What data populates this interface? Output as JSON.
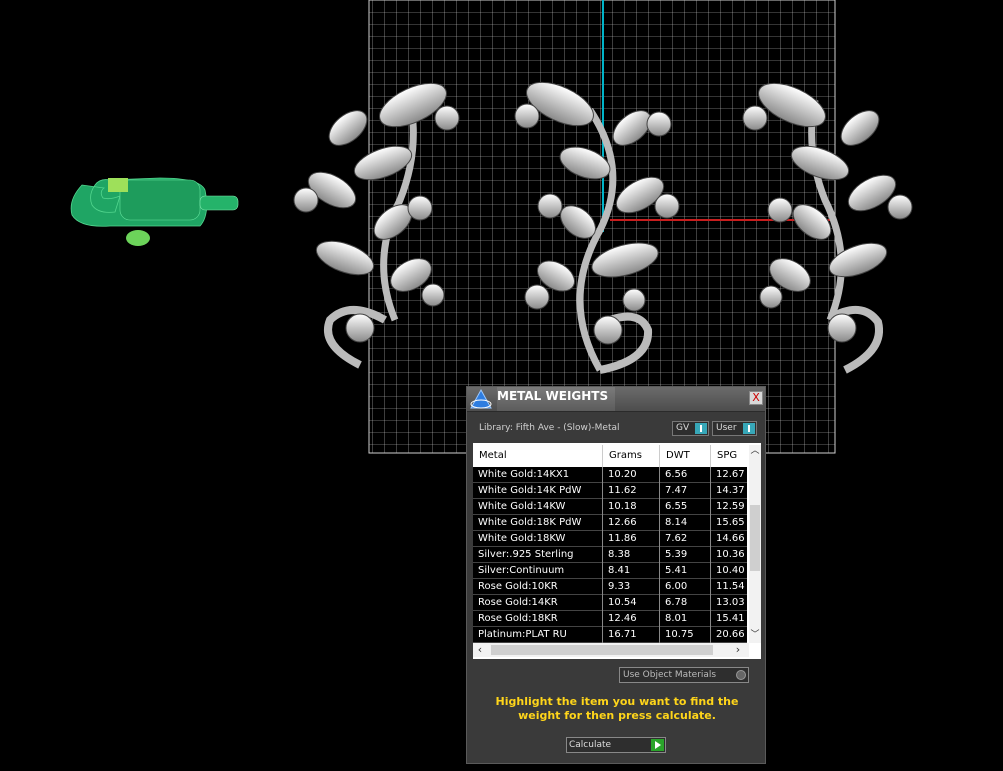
{
  "dialog": {
    "title": "METAL WEIGHTS",
    "close_label": "X",
    "library_label": "Library: Fifth Ave - (Slow)-Metal",
    "toggle_gv_label": "GV",
    "toggle_user_label": "User",
    "columns": [
      "Metal",
      "Grams",
      "DWT",
      "SPG"
    ],
    "rows": [
      {
        "metal": "White Gold:14KX1",
        "grams": "10.20",
        "dwt": "6.56",
        "spg": "12.67"
      },
      {
        "metal": "White Gold:14K PdW",
        "grams": "11.62",
        "dwt": "7.47",
        "spg": "14.37"
      },
      {
        "metal": "White Gold:14KW",
        "grams": "10.18",
        "dwt": "6.55",
        "spg": "12.59"
      },
      {
        "metal": "White Gold:18K PdW",
        "grams": "12.66",
        "dwt": "8.14",
        "spg": "15.65"
      },
      {
        "metal": "White Gold:18KW",
        "grams": "11.86",
        "dwt": "7.62",
        "spg": "14.66"
      },
      {
        "metal": "Silver:.925 Sterling",
        "grams": "8.38",
        "dwt": "5.39",
        "spg": "10.36"
      },
      {
        "metal": "Silver:Continuum",
        "grams": "8.41",
        "dwt": "5.41",
        "spg": "10.40"
      },
      {
        "metal": "Rose Gold:10KR",
        "grams": "9.33",
        "dwt": "6.00",
        "spg": "11.54"
      },
      {
        "metal": "Rose Gold:14KR",
        "grams": "10.54",
        "dwt": "6.78",
        "spg": "13.03"
      },
      {
        "metal": "Rose Gold:18KR",
        "grams": "12.46",
        "dwt": "8.01",
        "spg": "15.41"
      },
      {
        "metal": "Platinum:PLAT RU",
        "grams": "16.71",
        "dwt": "10.75",
        "spg": "20.66"
      }
    ],
    "use_object_materials_label": "Use Object Materials",
    "hint_text": "Highlight the item you want to find the weight for then press calculate.",
    "calculate_label": "Calculate"
  },
  "colors": {
    "background": "#000000",
    "grid": "#cfcfcf",
    "accent_toggle": "#37a7b8",
    "hint": "#ffd51a",
    "go_button": "#2aa42a",
    "clasp": "#1fa564",
    "axis_y": "#00b4c8",
    "axis_x": "#c81e1e"
  }
}
